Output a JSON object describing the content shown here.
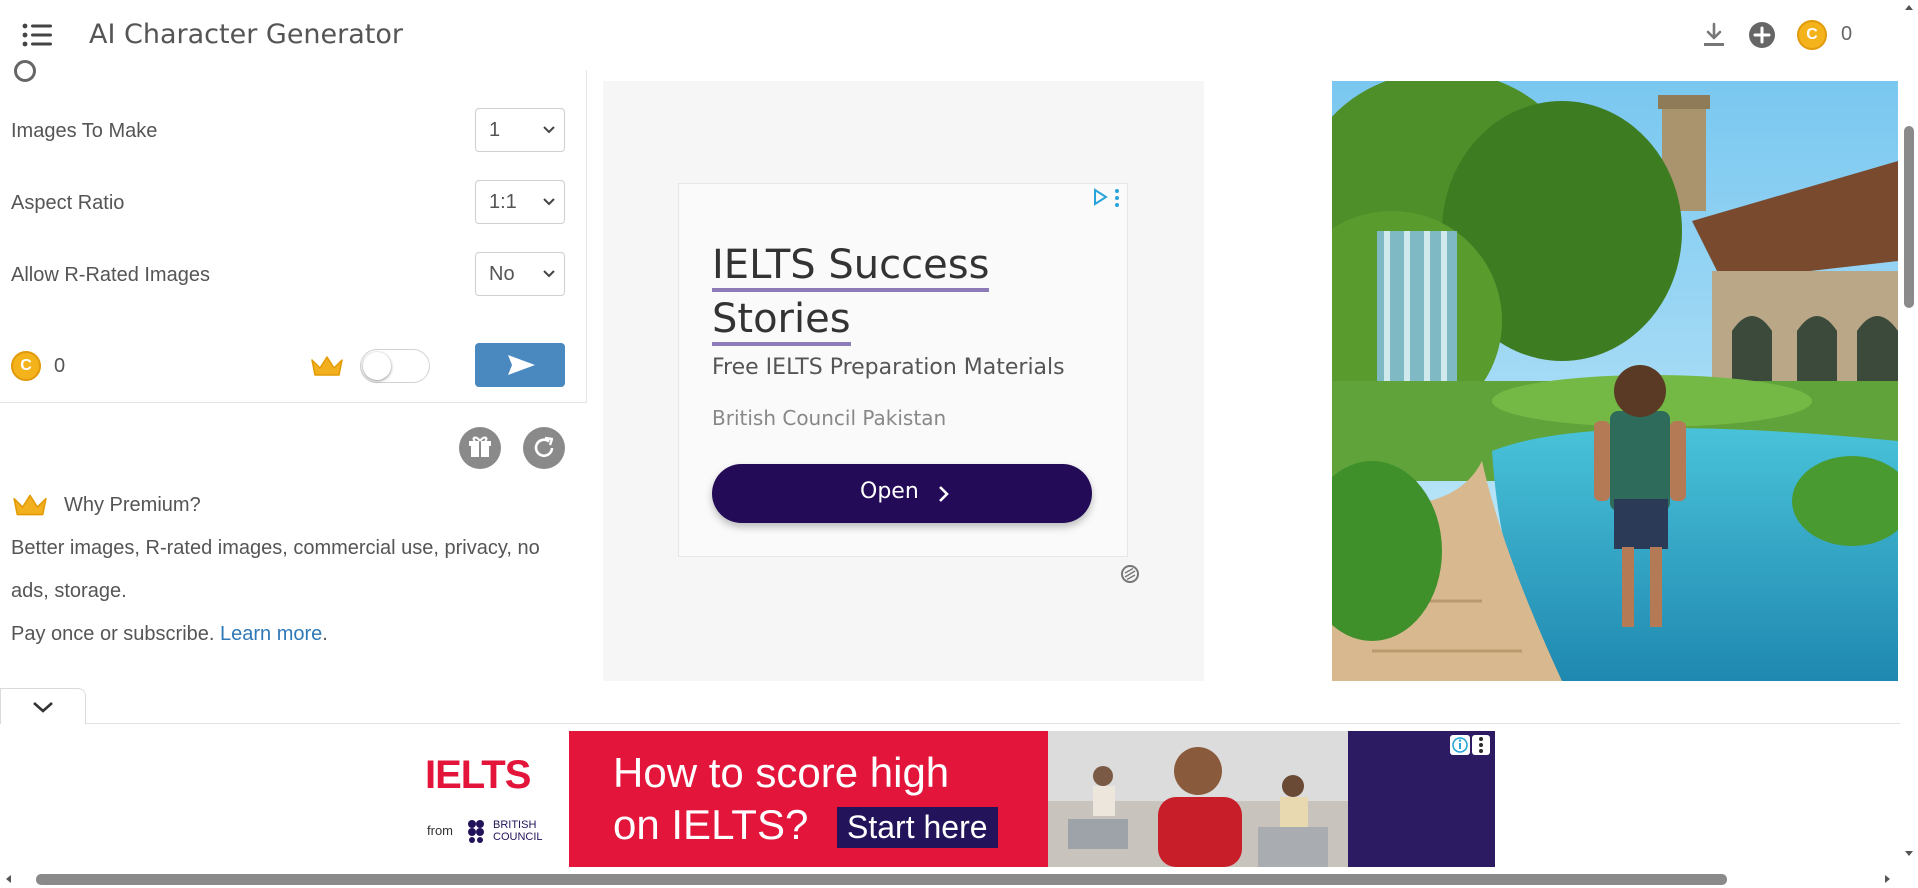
{
  "header": {
    "title": "AI Character Generator",
    "coin_count": "0",
    "icons": [
      "menu-icon",
      "download-icon",
      "add-circle-icon",
      "coin-icon"
    ]
  },
  "options": {
    "images_to_make": {
      "label": "Images To Make",
      "value": "1"
    },
    "aspect_ratio": {
      "label": "Aspect Ratio",
      "value": "1:1"
    },
    "allow_r_rated": {
      "label": "Allow R-Rated Images",
      "value": "No"
    }
  },
  "generate_row": {
    "coin_count": "0",
    "premium_toggle": false
  },
  "premium": {
    "title": "Why Premium?",
    "line1": "Better images, R-rated images, commercial use, privacy, no",
    "line2": "ads, storage.",
    "line3": "Pay once or subscribe.",
    "link": "Learn more",
    "link_suffix": "."
  },
  "ad": {
    "headline_1": "IELTS Success",
    "headline_2": "Stories",
    "subtitle": "Free IELTS Preparation Materials",
    "brand": "British Council Pakistan",
    "button_label": "Open"
  },
  "banner": {
    "logo": "IELTS",
    "logo_from": "from",
    "logo_brand_1": "BRITISH",
    "logo_brand_2": "COUNCIL",
    "line1": "How to score high",
    "line2": "on IELTS?",
    "cta": "Start here"
  },
  "colors": {
    "accent_blue": "#4a89c0",
    "coin_gold": "#f4b21b",
    "crown_gold": "#f2b01e",
    "ad_button": "#230b57",
    "banner_red": "#e3153b",
    "banner_purple": "#2c1a63"
  }
}
